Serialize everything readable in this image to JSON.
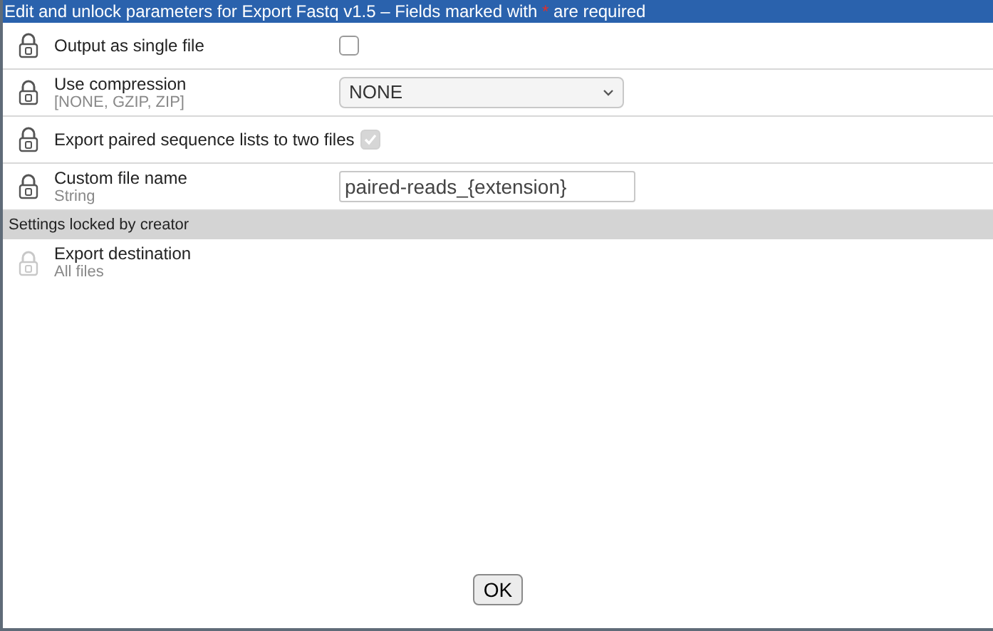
{
  "title": {
    "text_before": "Edit and unlock parameters for Export Fastq v1.5 – Fields marked with",
    "required_mark": "*",
    "text_after": "are required"
  },
  "parameters": [
    {
      "kind": "checkbox",
      "label": "Output as single file",
      "checked": false,
      "disabled": false
    },
    {
      "kind": "select",
      "label": "Use compression",
      "hint": "[NONE, GZIP, ZIP]",
      "value": "NONE"
    },
    {
      "kind": "checkbox",
      "label": "Export paired sequence lists to two files",
      "checked": true,
      "disabled": true
    },
    {
      "kind": "text",
      "label": "Custom file name",
      "hint": "String",
      "value": "paired-reads_{extension}"
    }
  ],
  "locked_section": {
    "title": "Settings locked by creator",
    "items": [
      {
        "label": "Export destination",
        "hint": "All files"
      }
    ]
  },
  "ok_button": "OK"
}
